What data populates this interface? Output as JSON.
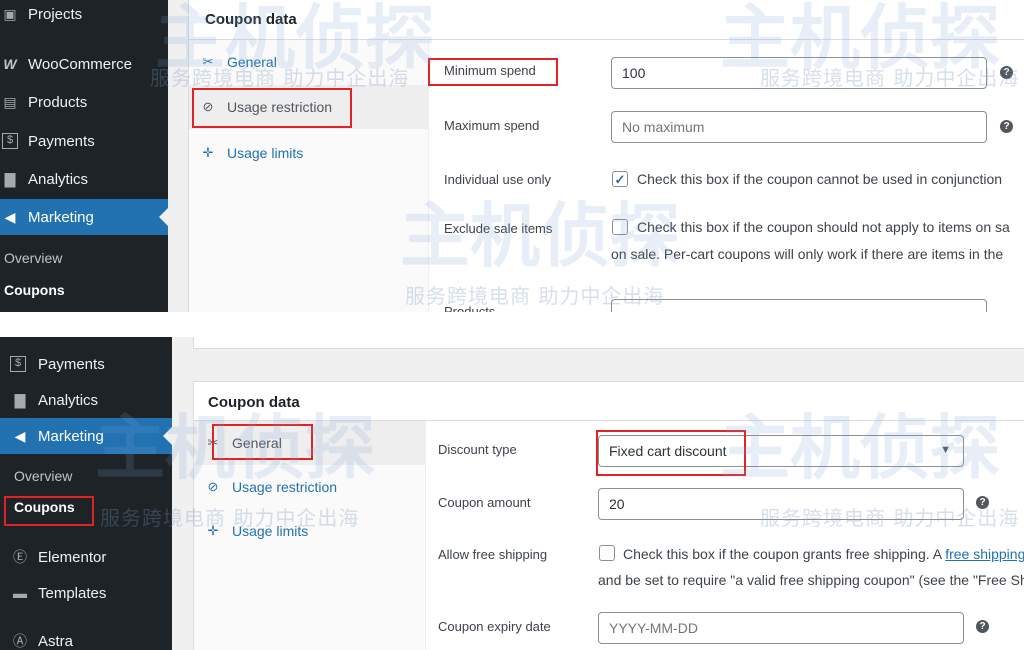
{
  "top": {
    "sidebar": {
      "items": [
        {
          "label": "Projects",
          "icon": "projects-icon",
          "glyph": "▣"
        },
        {
          "label": "WooCommerce",
          "icon": "woocommerce-icon",
          "glyph": "W"
        },
        {
          "label": "Products",
          "icon": "products-icon",
          "glyph": "▤"
        },
        {
          "label": "Payments",
          "icon": "payments-icon",
          "glyph": "$"
        },
        {
          "label": "Analytics",
          "icon": "analytics-icon",
          "glyph": "▇"
        },
        {
          "label": "Marketing",
          "icon": "megaphone-icon",
          "glyph": "◀"
        }
      ],
      "sub_items": [
        "Overview",
        "Coupons"
      ]
    },
    "box_title": "Coupon data",
    "tabs": [
      {
        "label": "General",
        "icon": "ticket-icon",
        "glyph": "✂"
      },
      {
        "label": "Usage restriction",
        "icon": "block-icon",
        "glyph": "⊘"
      },
      {
        "label": "Usage limits",
        "icon": "limits-icon",
        "glyph": "✛"
      }
    ],
    "fields": {
      "min_spend_label": "Minimum spend",
      "min_spend_value": "100",
      "max_spend_label": "Maximum spend",
      "max_spend_placeholder": "No maximum",
      "individual_label": "Individual use only",
      "individual_text": "Check this box if the coupon cannot be used in conjunction",
      "individual_checked": true,
      "exclude_label": "Exclude sale items",
      "exclude_text": "Check this box if the coupon should not apply to items on sa",
      "exclude_text2": "on sale. Per-cart coupons will only work if there are items in the",
      "products_label": "Products"
    }
  },
  "bottom": {
    "sidebar": {
      "items": [
        {
          "label": "Payments",
          "icon": "payments-icon",
          "glyph": "$"
        },
        {
          "label": "Analytics",
          "icon": "analytics-icon",
          "glyph": "▇"
        },
        {
          "label": "Marketing",
          "icon": "megaphone-icon",
          "glyph": "◀"
        }
      ],
      "sub_items": [
        "Overview",
        "Coupons"
      ],
      "extra_items": [
        {
          "label": "Elementor",
          "icon": "elementor-icon",
          "glyph": "Ⓔ"
        },
        {
          "label": "Templates",
          "icon": "folder-icon",
          "glyph": "▬"
        },
        {
          "label": "Astra",
          "icon": "astra-icon",
          "glyph": "Ⓐ"
        }
      ]
    },
    "box_title": "Coupon data",
    "tabs": [
      {
        "label": "General",
        "icon": "ticket-icon",
        "glyph": "✂"
      },
      {
        "label": "Usage restriction",
        "icon": "block-icon",
        "glyph": "⊘"
      },
      {
        "label": "Usage limits",
        "icon": "limits-icon",
        "glyph": "✛"
      }
    ],
    "fields": {
      "discount_type_label": "Discount type",
      "discount_type_value": "Fixed cart discount",
      "amount_label": "Coupon amount",
      "amount_value": "20",
      "free_shipping_label": "Allow free shipping",
      "free_shipping_text": "Check this box if the coupon grants free shipping. A",
      "free_shipping_link": "free shipping",
      "free_shipping_text2": "and be set to require \"a valid free shipping coupon\" (see the \"Free Sh",
      "expiry_label": "Coupon expiry date",
      "expiry_placeholder": "YYYY-MM-DD"
    }
  },
  "watermark": {
    "tagline": "服务跨境电商 助力中企出海",
    "brand": "主机侦探"
  },
  "colors": {
    "sidebar_bg": "#1d2327",
    "accent": "#2271b1",
    "highlight": "#e02424"
  }
}
